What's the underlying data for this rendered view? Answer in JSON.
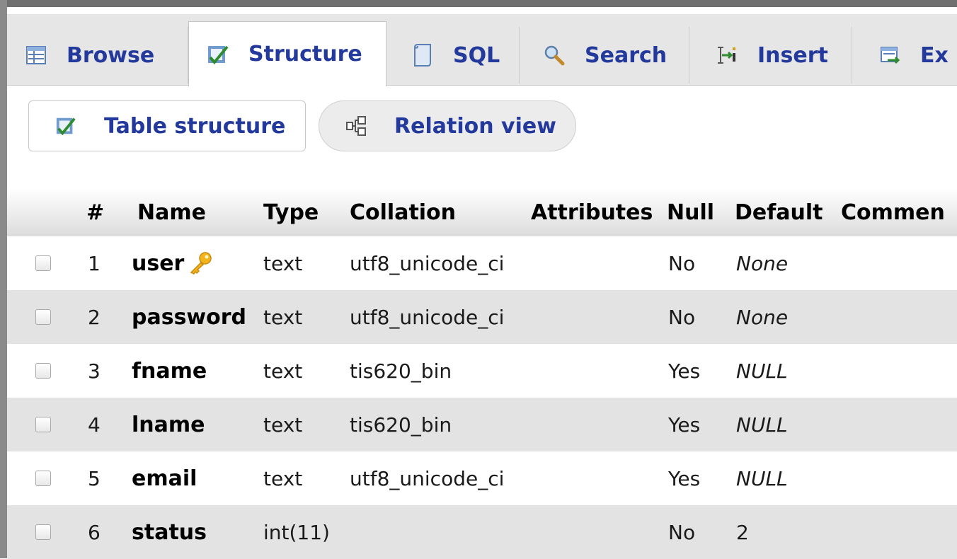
{
  "tabs": [
    {
      "label": "Browse",
      "icon": "browse-icon",
      "active": false
    },
    {
      "label": "Structure",
      "icon": "structure-icon",
      "active": true
    },
    {
      "label": "SQL",
      "icon": "sql-icon",
      "active": false
    },
    {
      "label": "Search",
      "icon": "search-icon",
      "active": false
    },
    {
      "label": "Insert",
      "icon": "insert-icon",
      "active": false
    },
    {
      "label": "Ex",
      "icon": "export-icon",
      "active": false
    }
  ],
  "subnav": {
    "table_structure": "Table structure",
    "relation_view": "Relation view"
  },
  "table": {
    "headers": {
      "num": "#",
      "name": "Name",
      "type": "Type",
      "collation": "Collation",
      "attributes": "Attributes",
      "null": "Null",
      "default": "Default",
      "comments": "Commen"
    },
    "rows": [
      {
        "num": "1",
        "name": "user",
        "primary_key": true,
        "type": "text",
        "collation": "utf8_unicode_ci",
        "attributes": "",
        "null": "No",
        "default": "None"
      },
      {
        "num": "2",
        "name": "password",
        "primary_key": false,
        "type": "text",
        "collation": "utf8_unicode_ci",
        "attributes": "",
        "null": "No",
        "default": "None"
      },
      {
        "num": "3",
        "name": "fname",
        "primary_key": false,
        "type": "text",
        "collation": "tis620_bin",
        "attributes": "",
        "null": "Yes",
        "default": "NULL"
      },
      {
        "num": "4",
        "name": "lname",
        "primary_key": false,
        "type": "text",
        "collation": "tis620_bin",
        "attributes": "",
        "null": "Yes",
        "default": "NULL"
      },
      {
        "num": "5",
        "name": "email",
        "primary_key": false,
        "type": "text",
        "collation": "utf8_unicode_ci",
        "attributes": "",
        "null": "Yes",
        "default": "NULL"
      },
      {
        "num": "6",
        "name": "status",
        "primary_key": false,
        "type": "int(11)",
        "collation": "",
        "attributes": "",
        "null": "No",
        "default": "2"
      }
    ]
  },
  "colors": {
    "link": "#23399b",
    "tab_bar": "#e6e6e6",
    "row_shade": "#e3e3e3",
    "key_icon": "#f2b41d"
  }
}
